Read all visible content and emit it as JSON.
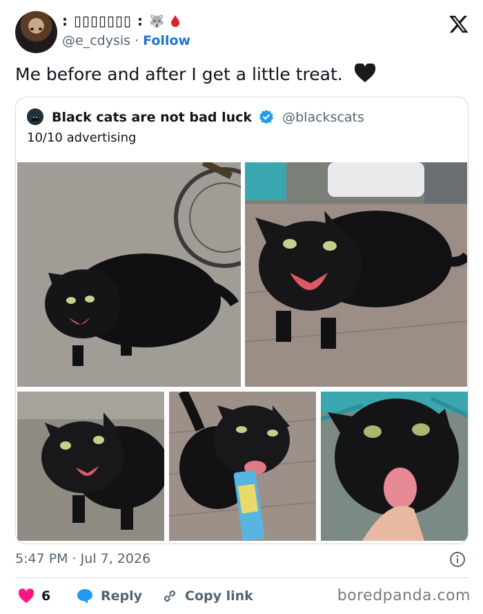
{
  "author": {
    "display_name": ": ▯▯▯▯▯▯▯ :",
    "handle": "@e_cdysis",
    "separator": "·",
    "follow_label": "Follow"
  },
  "tweet": {
    "text": "Me before and after I get a little treat."
  },
  "quoted": {
    "name": "Black cats are not bad luck",
    "handle": "@blackscats",
    "text": "10/10 advertising"
  },
  "meta": {
    "timestamp": "5:47 PM · Jul 7, 2026"
  },
  "actions": {
    "like_count": "6",
    "reply_label": "Reply",
    "copy_label": "Copy link"
  },
  "watermark": "boredpanda.com",
  "colors": {
    "link_blue": "#1d74d7",
    "like_red": "#f91880",
    "reply_blue": "#1d9bf0",
    "verified_blue": "#1d9bf0",
    "muted": "#536471",
    "border": "#cfd9de"
  },
  "icons": [
    "wolf-emoji-icon",
    "blood-drop-icon",
    "x-logo-icon",
    "black-heart-icon",
    "verified-badge-icon",
    "info-icon",
    "heart-icon",
    "reply-bubble-icon",
    "link-icon"
  ]
}
